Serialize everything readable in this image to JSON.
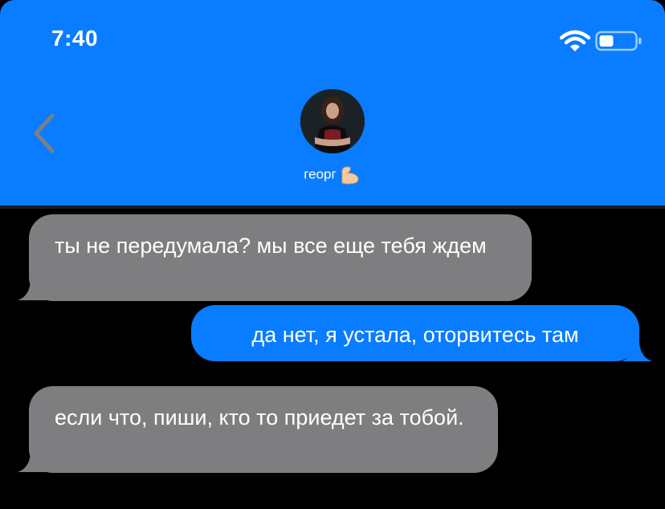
{
  "status_bar": {
    "time": "7:40"
  },
  "colors": {
    "header_bg": "#0a7cff",
    "incoming_bubble": "#7e7e80",
    "outgoing_bubble": "#0a7cff",
    "background": "#000000"
  },
  "header": {
    "back_icon": "chevron-left-icon",
    "contact_name": "георг",
    "contact_emoji": "flexed-biceps-emoji"
  },
  "messages": [
    {
      "direction": "incoming",
      "text": "ты не передумала? мы все еще тебя ждем"
    },
    {
      "direction": "outgoing",
      "text": "да нет, я устала, оторвитесь там"
    },
    {
      "direction": "incoming",
      "text": "если что, пиши, кто то приедет за тобой."
    }
  ]
}
